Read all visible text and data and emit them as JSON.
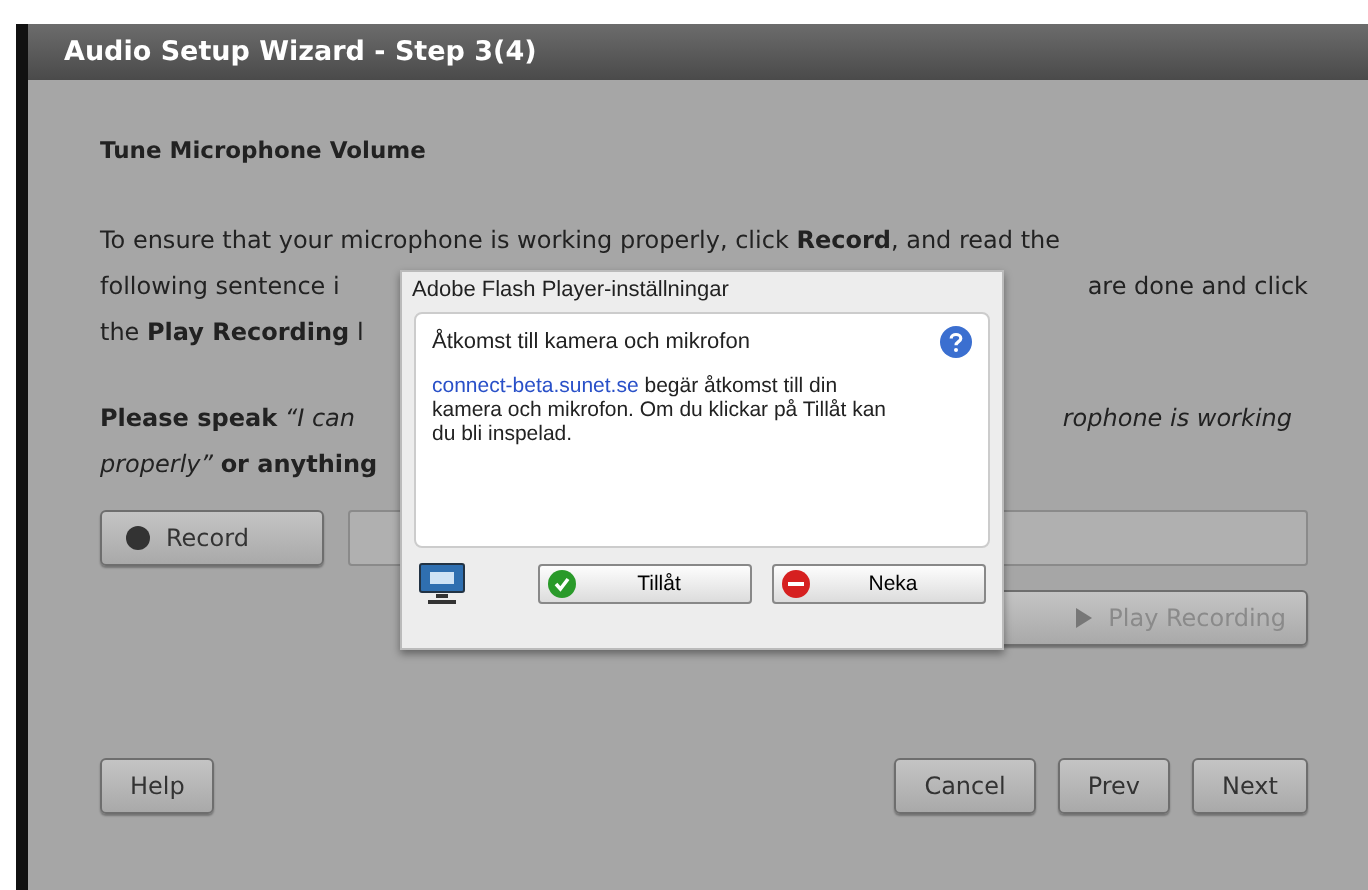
{
  "window": {
    "title": "Audio Setup Wizard - Step 3(4)"
  },
  "heading": "Tune Microphone Volume",
  "paragraphs": [
    {
      "lines": [
        {
          "left": "To ensure that your microphone is working properly, click **Record**, and read the"
        },
        {
          "left": "following sentence i",
          "right": "are done and click"
        },
        {
          "left": "the **Play Recording** l"
        }
      ]
    },
    {
      "lines": [
        {
          "left": "**Please speak** *“I can*",
          "right": "*rophone is working*"
        },
        {
          "left": "*properly”* **or anything**"
        }
      ]
    }
  ],
  "record_button": {
    "label": "Record"
  },
  "play_button": {
    "label": "Play Recording",
    "disabled": true
  },
  "dialog": {
    "title": "Adobe Flash Player-inställningar",
    "heading": "Åtkomst till kamera och mikrofon",
    "link": "connect-beta.sunet.se",
    "message": " begär åtkomst till din kamera och mikrofon. Om du klickar på Tillåt kan du bli inspelad.",
    "allow_button": "Tillåt",
    "deny_button": "Neka"
  },
  "footer": {
    "help_button": "Help",
    "buttons": [
      "Cancel",
      "Prev",
      "Next"
    ]
  }
}
